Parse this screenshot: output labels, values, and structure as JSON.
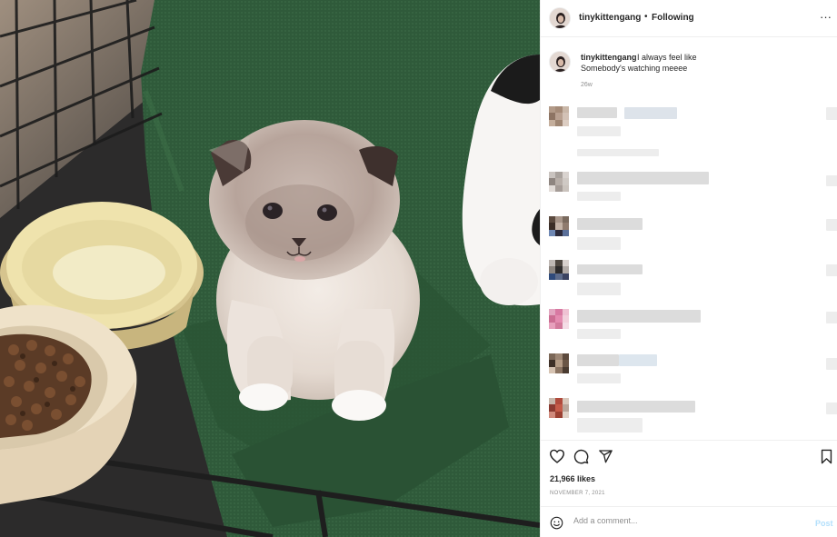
{
  "post": {
    "username": "tinykittengang",
    "separator": "•",
    "follow_label": "Following",
    "more_label": "···"
  },
  "caption": {
    "username": "tinykittengang",
    "text_line1": "I always feel like",
    "text_line2": "Somebody's watching meeee",
    "time": "26w"
  },
  "actions": {
    "likes": "21,966 likes",
    "date": "NOVEMBER 7, 2021"
  },
  "comment_box": {
    "placeholder": "Add a comment...",
    "post_label": "Post"
  },
  "colors": {
    "towel": "#2f5a3a",
    "link_disabled": "#b2dffc",
    "secondary_text": "#8e8e8e",
    "divider": "#efefef"
  },
  "icons": [
    "heart-icon",
    "comment-icon",
    "share-icon",
    "bookmark-icon",
    "more-icon",
    "emoji-icon"
  ]
}
